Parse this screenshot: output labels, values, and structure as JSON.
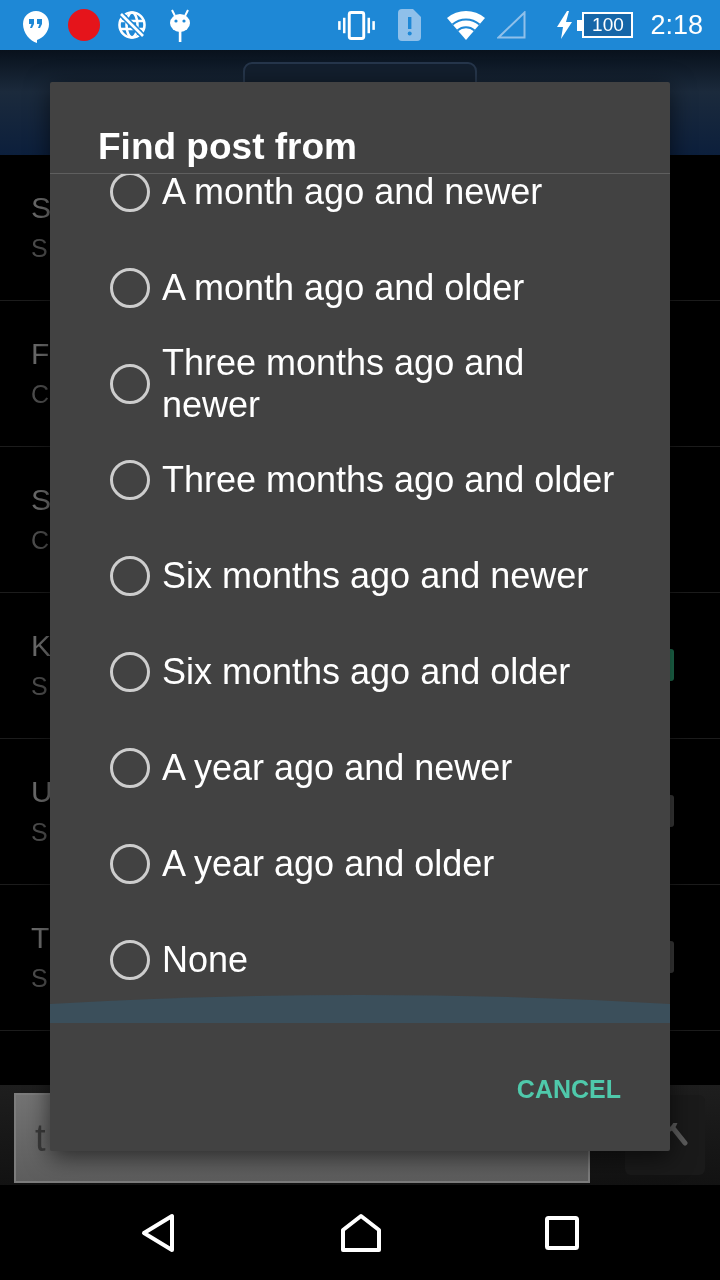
{
  "status_bar": {
    "battery": "100",
    "time": "2:18"
  },
  "list_rows": [
    {
      "title": "S",
      "subtitle": "S"
    },
    {
      "title": "F",
      "subtitle": "C"
    },
    {
      "title": "S",
      "subtitle": "C"
    },
    {
      "title": "K",
      "subtitle": "S",
      "switch": {
        "on": true
      }
    },
    {
      "title": "U",
      "subtitle": "S",
      "switch": {
        "on": false
      }
    },
    {
      "title": "T",
      "subtitle": "S",
      "switch": {
        "on": false
      }
    }
  ],
  "search_bar": {
    "placeholder": "t"
  },
  "dialog": {
    "title": "Find post from",
    "options": [
      {
        "label": "A month ago and newer",
        "selected": false
      },
      {
        "label": "A month ago and older",
        "selected": false
      },
      {
        "label": "Three months ago and newer",
        "selected": false
      },
      {
        "label": "Three months ago and older",
        "selected": false
      },
      {
        "label": "Six months ago and newer",
        "selected": false
      },
      {
        "label": "Six months ago and older",
        "selected": false
      },
      {
        "label": "A year ago and newer",
        "selected": false
      },
      {
        "label": "A year ago and older",
        "selected": false
      },
      {
        "label": "None",
        "selected": false
      }
    ],
    "buttons": [
      "CANCEL"
    ]
  }
}
